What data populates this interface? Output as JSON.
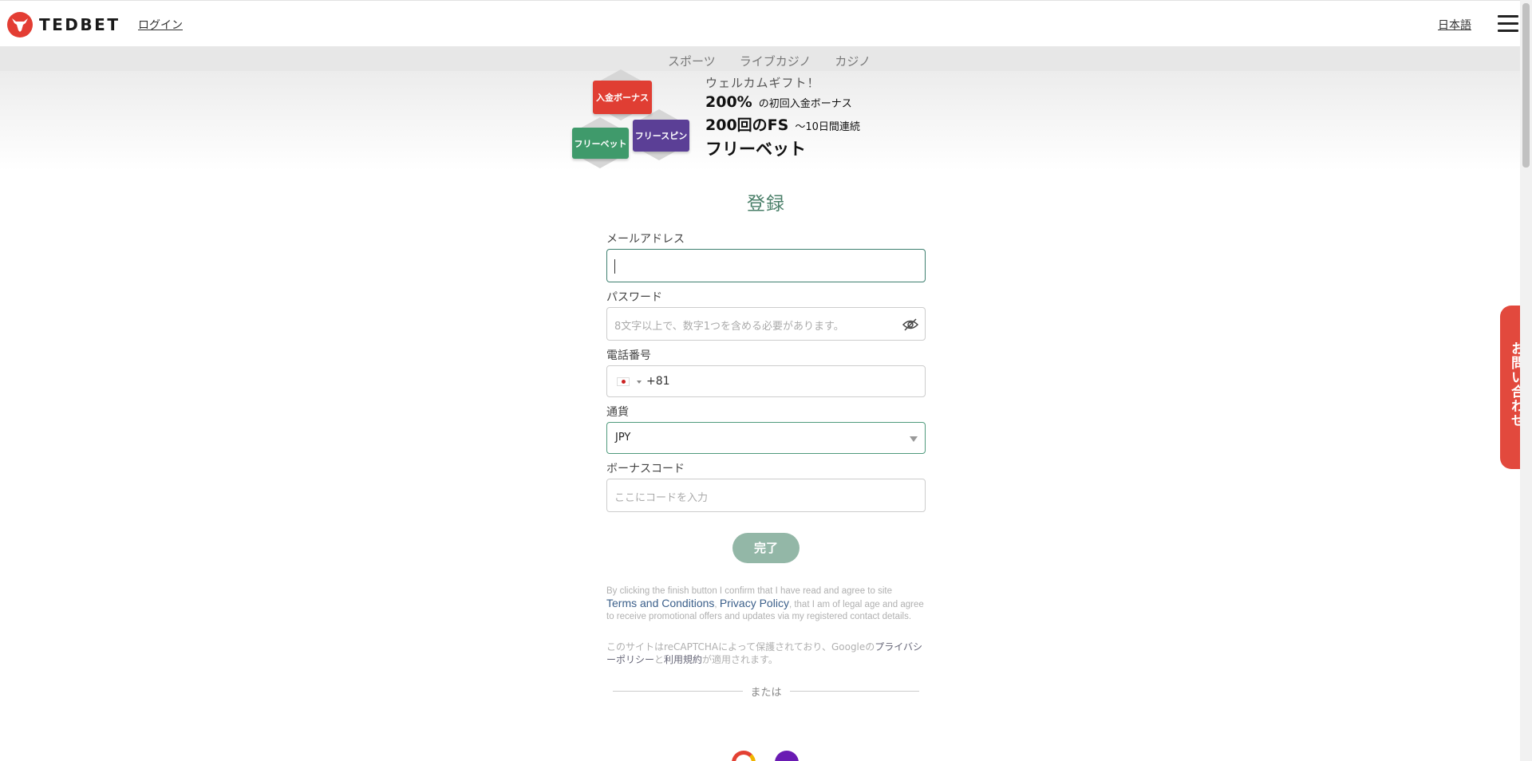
{
  "header": {
    "brand": "TEDBET",
    "login": "ログイン",
    "language": "日本語"
  },
  "tabs": [
    "スポーツ",
    "ライブカジノ",
    "カジノ"
  ],
  "promo": {
    "badges": {
      "deposit": "入金ボーナス",
      "free_spin": "フリースピン",
      "free_bet": "フリーベット"
    },
    "welcome": "ウェルカムギフト！",
    "line1_big": "200%",
    "line1_small": "の初回入金ボーナス",
    "line2_big": "200回のFS",
    "line2_small": "～10日間連続",
    "line3": "フリーベット"
  },
  "form": {
    "title": "登録",
    "email_label": "メールアドレス",
    "email_value": "",
    "password_label": "パスワード",
    "password_placeholder": "8文字以上で、数字1つを含める必要があります。",
    "phone_label": "電話番号",
    "phone_code": "+81",
    "currency_label": "通貨",
    "currency_value": "JPY",
    "bonus_label": "ボーナスコード",
    "bonus_placeholder": "ここにコードを入力",
    "submit": "完了"
  },
  "terms": {
    "prefix": "By clicking the finish button I confirm that I have read and agree to site",
    "link1": "Terms and Conditions",
    "comma": ",",
    "link2": "Privacy Policy",
    "suffix": ", that I am of legal age and agree to receive promotional offers and updates via my registered contact details."
  },
  "recaptcha": {
    "prefix": "このサイトはreCAPTCHAによって保護されており、Googleの",
    "link1": "プライバシーポリシー",
    "and": "と",
    "link2": "利用規約",
    "suffix": "が適用されます。"
  },
  "or": "または",
  "contact": "お問い合わせ",
  "colors": {
    "brand_red": "#e33d33",
    "green": "#4a7f69",
    "submit_green": "#93b7a7",
    "purple": "#5b3f96"
  }
}
